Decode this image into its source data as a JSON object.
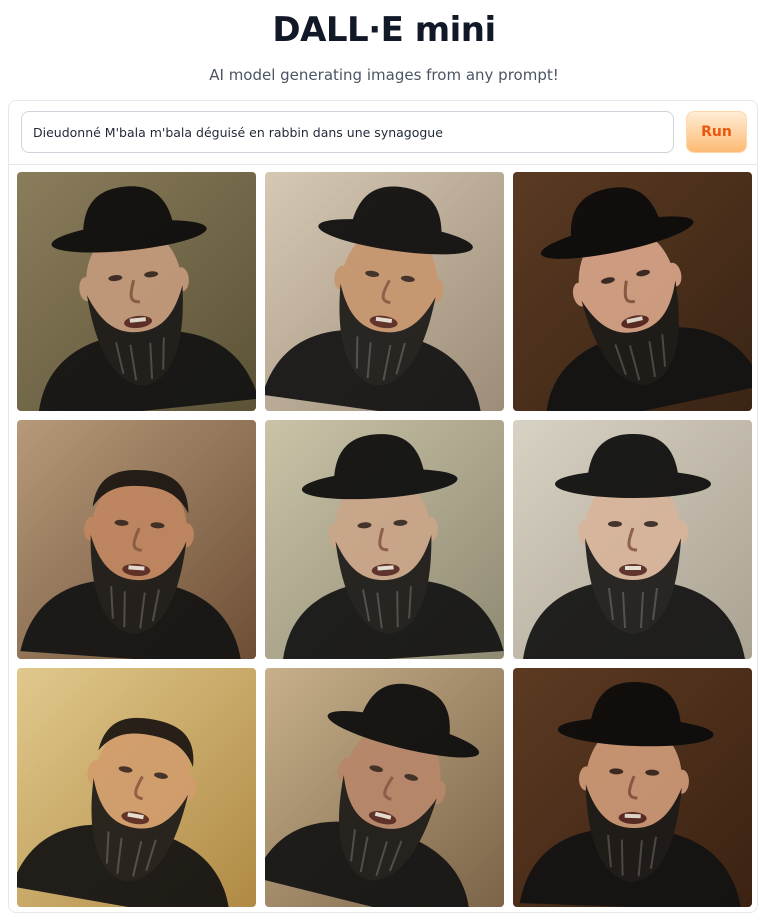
{
  "app": {
    "title": "DALL·E mini",
    "subtitle": "AI model generating images from any prompt!"
  },
  "prompt": {
    "value": "Dieudonné M'bala m'bala déguisé en rabbin dans une synagogue",
    "placeholder": ""
  },
  "run_button": {
    "label": "Run"
  },
  "colors": {
    "accent": "#ea580c",
    "run_bg_top": "#ffedd5",
    "run_bg_bottom": "#fdba74",
    "border": "#e5e7eb"
  },
  "gallery": {
    "images": [
      {
        "bg": "#8a7d5c",
        "bg2": "#5c5236",
        "skin": "#c49a7c",
        "hat": true,
        "tilt": -6
      },
      {
        "bg": "#d6c9b4",
        "bg2": "#9c8c78",
        "skin": "#c7966e",
        "hat": true,
        "tilt": 8
      },
      {
        "bg": "#5a3a22",
        "bg2": "#3a2414",
        "skin": "#d8a488",
        "hat": true,
        "tilt": -12
      },
      {
        "bg": "#b69a7a",
        "bg2": "#6e4f36",
        "skin": "#c08660",
        "hat": false,
        "tilt": 4
      },
      {
        "bg": "#c9c3a8",
        "bg2": "#8f8a72",
        "skin": "#caa588",
        "hat": true,
        "tilt": -4
      },
      {
        "bg": "#d8d2c4",
        "bg2": "#aaa292",
        "skin": "#d7b49a",
        "hat": true,
        "tilt": 0
      },
      {
        "bg": "#e0c88c",
        "bg2": "#b08a44",
        "skin": "#d19c6c",
        "hat": false,
        "tilt": 10
      },
      {
        "bg": "#c7b08a",
        "bg2": "#7b6448",
        "skin": "#b8866a",
        "hat": true,
        "tilt": 14
      },
      {
        "bg": "#5c3a22",
        "bg2": "#3b2212",
        "skin": "#cf9a78",
        "hat": true,
        "tilt": 2
      }
    ]
  }
}
